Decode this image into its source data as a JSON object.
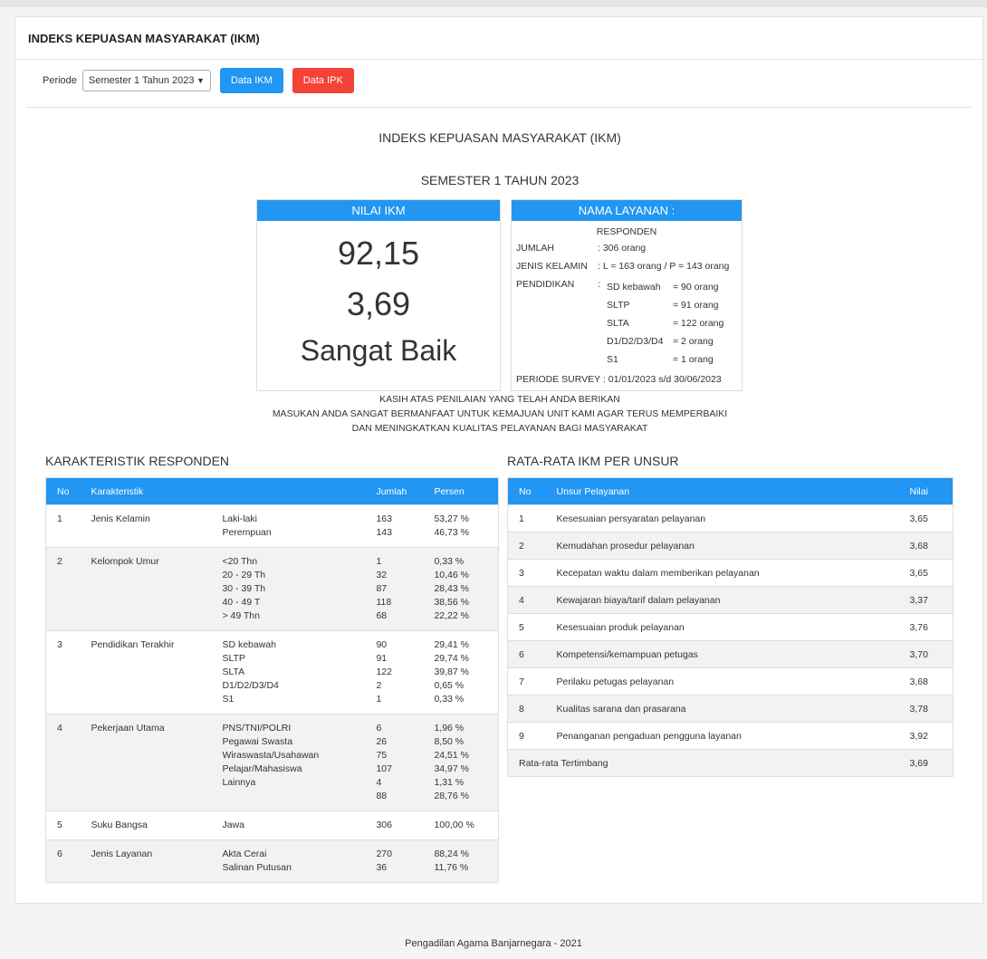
{
  "card_title": "INDEKS KEPUASAN MASYARAKAT (IKM)",
  "filter": {
    "label": "Periode",
    "selected": "Semester 1 Tahun 2023",
    "btn_ikm": "Data IKM",
    "btn_ipk": "Data IPK"
  },
  "heading": "INDEKS KEPUASAN MASYARAKAT (IKM)",
  "subheading": "SEMESTER 1 TAHUN 2023",
  "nilai": {
    "header": "NILAI IKM",
    "score": "92,15",
    "index": "3,69",
    "category": "Sangat Baik"
  },
  "layanan": {
    "header": "NAMA LAYANAN :",
    "responden": "RESPONDEN",
    "jumlah_label": "JUMLAH",
    "jumlah_value": ": 306 orang",
    "jk_label": "JENIS KELAMIN",
    "jk_value": ": L = 163 orang / P = 143 orang",
    "pend_label": "PENDIDIKAN",
    "pend_colon": ":",
    "pend": [
      {
        "k": "SD kebawah",
        "v": "= 90 orang"
      },
      {
        "k": "SLTP",
        "v": "= 91 orang"
      },
      {
        "k": "SLTA",
        "v": "= 122 orang"
      },
      {
        "k": "D1/D2/D3/D4",
        "v": "= 2 orang"
      },
      {
        "k": "S1",
        "v": "= 1 orang"
      }
    ],
    "periode": "PERIODE SURVEY : 01/01/2023 s/d 30/06/2023"
  },
  "note": [
    "KASIH ATAS PENILAIAN YANG TELAH ANDA BERIKAN",
    "MASUKAN ANDA SANGAT BERMANFAAT UNTUK KEMAJUAN UNIT KAMI AGAR TERUS MEMPERBAIKI",
    "DAN MENINGKATKAN KUALITAS PELAYANAN BAGI MASYARAKAT"
  ],
  "karakteristik": {
    "title": "KARAKTERISTIK RESPONDEN",
    "headers": [
      "No",
      "Karakteristik",
      "",
      "Jumlah",
      "Persen"
    ],
    "rows": [
      {
        "no": "1",
        "name": "Jenis Kelamin",
        "items": [
          [
            "Laki-laki",
            "163",
            "53,27 %"
          ],
          [
            "Perempuan",
            "143",
            "46,73 %"
          ]
        ]
      },
      {
        "no": "2",
        "name": "Kelompok Umur",
        "items": [
          [
            "<20 Thn",
            "1",
            "0,33 %"
          ],
          [
            "20 - 29 Th",
            "32",
            "10,46 %"
          ],
          [
            "30 - 39 Th",
            "87",
            "28,43 %"
          ],
          [
            "40 - 49 T",
            "118",
            "38,56 %"
          ],
          [
            "> 49 Thn",
            "68",
            "22,22 %"
          ]
        ]
      },
      {
        "no": "3",
        "name": "Pendidikan Terakhir",
        "items": [
          [
            "SD kebawah",
            "90",
            "29,41 %"
          ],
          [
            "SLTP",
            "91",
            "29,74 %"
          ],
          [
            "SLTA",
            "122",
            "39,87 %"
          ],
          [
            "D1/D2/D3/D4",
            "2",
            "0,65 %"
          ],
          [
            "S1",
            "1",
            "0,33 %"
          ]
        ]
      },
      {
        "no": "4",
        "name": "Pekerjaan Utama",
        "items": [
          [
            "PNS/TNI/POLRI",
            "6",
            "1,96 %"
          ],
          [
            "Pegawai Swasta",
            "26",
            "8,50 %"
          ],
          [
            "Wiraswasta/Usahawan",
            "75",
            "24,51 %"
          ],
          [
            "Pelajar/Mahasiswa",
            "107",
            "34,97 %"
          ],
          [
            "Lainnya",
            "4",
            "1,31 %"
          ],
          [
            "",
            "88",
            "28,76 %"
          ]
        ]
      },
      {
        "no": "5",
        "name": "Suku Bangsa",
        "items": [
          [
            "Jawa",
            "306",
            "100,00 %"
          ]
        ]
      },
      {
        "no": "6",
        "name": "Jenis Layanan",
        "items": [
          [
            "Akta Cerai",
            "270",
            "88,24 %"
          ],
          [
            "Salinan Putusan",
            "36",
            "11,76 %"
          ]
        ]
      }
    ]
  },
  "unsur": {
    "title": "RATA-RATA IKM PER UNSUR",
    "headers": [
      "No",
      "Unsur Pelayanan",
      "Nilai"
    ],
    "rows": [
      [
        "1",
        "Kesesuaian persyaratan pelayanan",
        "3,65"
      ],
      [
        "2",
        "Kemudahan prosedur pelayanan",
        "3,68"
      ],
      [
        "3",
        "Kecepatan waktu dalam memberikan pelayanan",
        "3,65"
      ],
      [
        "4",
        "Kewajaran biaya/tarif dalam pelayanan",
        "3,37"
      ],
      [
        "5",
        "Kesesuaian produk pelayanan",
        "3,76"
      ],
      [
        "6",
        "Kompetensi/kemampuan petugas",
        "3,70"
      ],
      [
        "7",
        "Perilaku petugas pelayanan",
        "3,68"
      ],
      [
        "8",
        "Kualitas sarana dan prasarana",
        "3,78"
      ],
      [
        "9",
        "Penanganan pengaduan pengguna layanan",
        "3,92"
      ]
    ],
    "avg_label": "Rata-rata Tertimbang",
    "avg_value": "3,69"
  },
  "footer": "Pengadilan Agama Banjarnegara - 2021",
  "colors": {
    "primary": "#2196f3",
    "danger": "#f44336"
  }
}
